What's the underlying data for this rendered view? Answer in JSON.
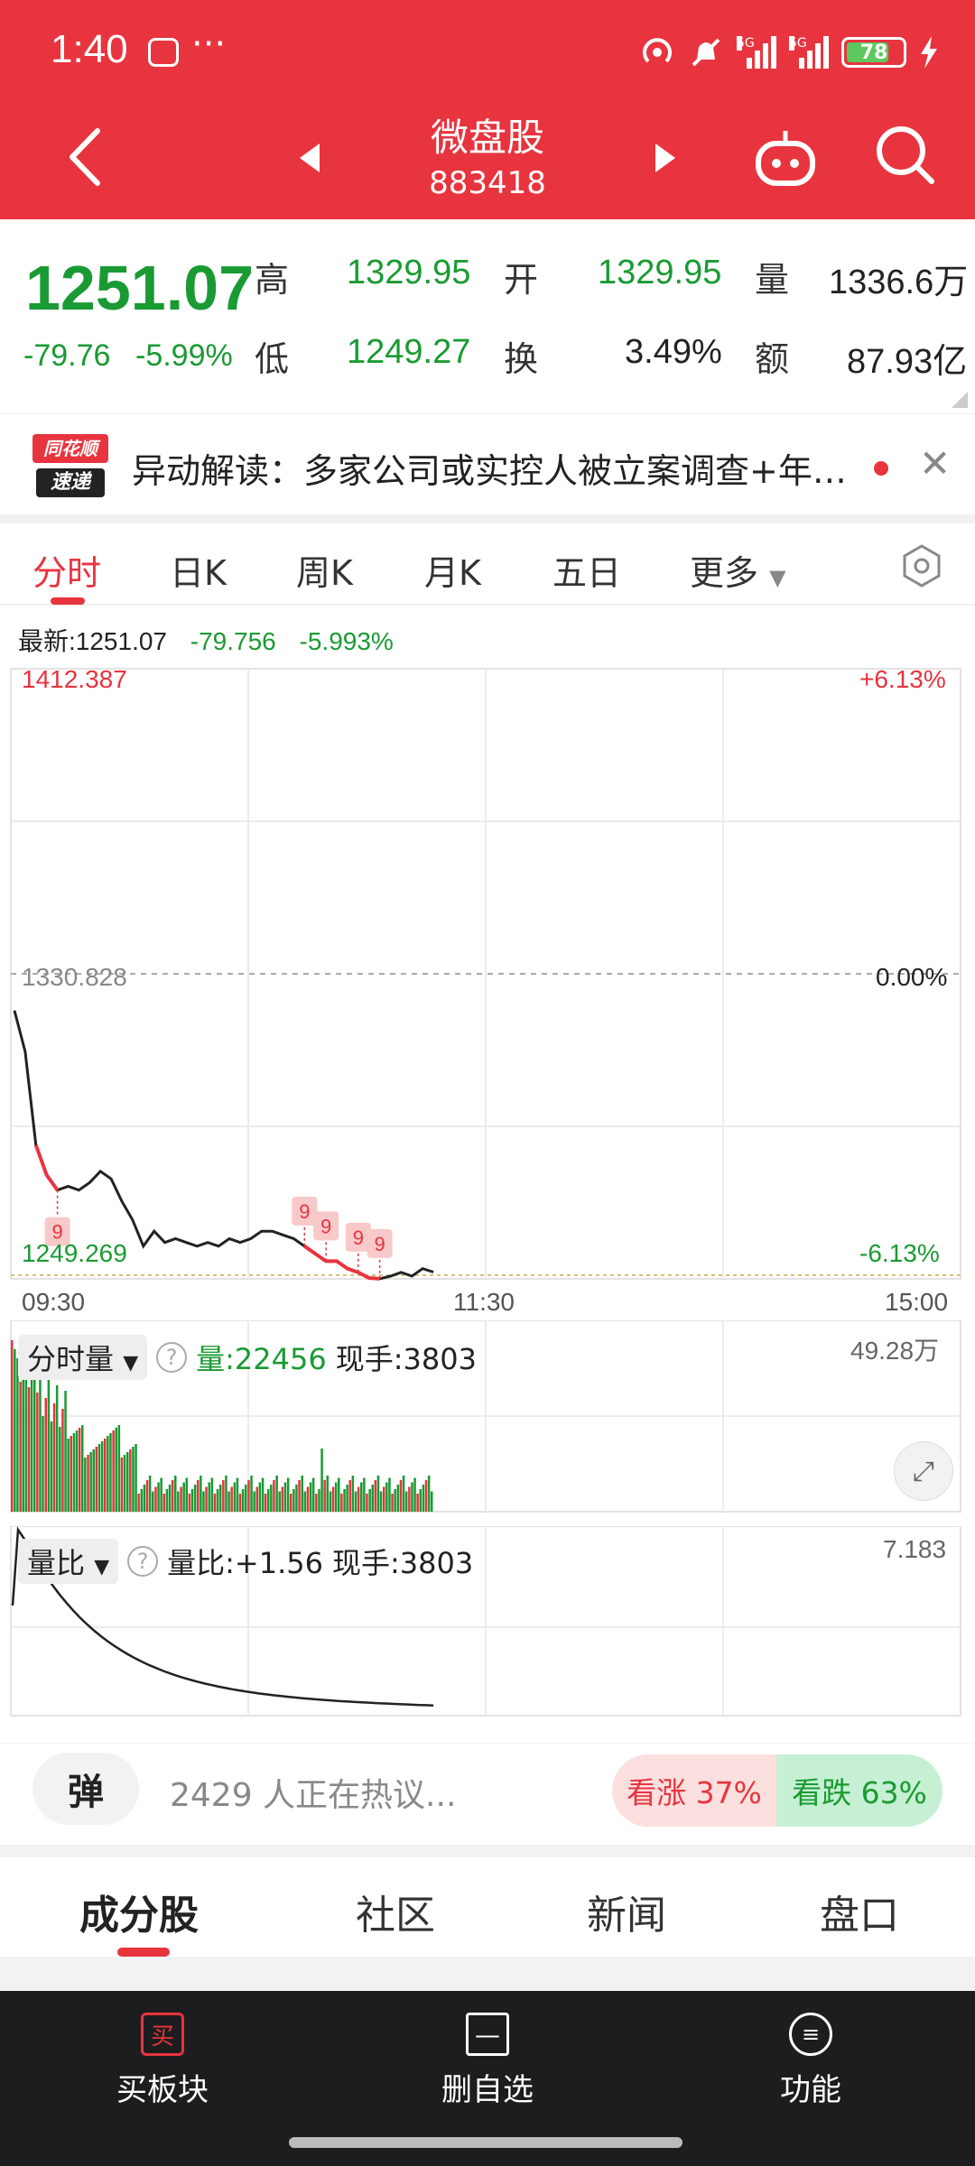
{
  "status_bar": {
    "time": "1:40",
    "more": "···",
    "battery": "78"
  },
  "nav": {
    "title": "微盘股",
    "code": "883418"
  },
  "quote": {
    "price": "1251.07",
    "change": "-79.76",
    "change_pct": "-5.99%",
    "high_label": "高",
    "high": "1329.95",
    "low_label": "低",
    "low": "1249.27",
    "open_label": "开",
    "open": "1329.95",
    "turnover_label": "换",
    "turnover": "3.49%",
    "volume_label": "量",
    "volume": "1336.6万",
    "amount_label": "额",
    "amount": "87.93亿"
  },
  "news": {
    "logo_top": "同花顺",
    "logo_bottom": "速递",
    "text": "异动解读：多家公司或实控人被立案调查+年…"
  },
  "tabs": {
    "items": [
      "分时",
      "日K",
      "周K",
      "月K",
      "五日",
      "更多"
    ]
  },
  "chart_header": {
    "latest": "最新:1251.07",
    "change": "-79.756",
    "change_pct": "-5.993%"
  },
  "price_axis": {
    "top": "1412.387",
    "mid": "1330.828",
    "bottom": "1249.269",
    "top_pct": "+6.13%",
    "mid_pct": "0.00%",
    "bottom_pct": "-6.13%"
  },
  "time_axis": {
    "start": "09:30",
    "mid": "11:30",
    "end": "15:00"
  },
  "volume_panel": {
    "selector": "分时量",
    "volume": "量:22456",
    "hand": "现手:3803",
    "max": "49.28万"
  },
  "ratio_panel": {
    "selector": "量比",
    "ratio": "量比:+1.56",
    "hand": "现手:3803",
    "max": "7.183"
  },
  "marker_label": "9",
  "discussion": {
    "danmu_label": "弹",
    "people": "2429 人正在热议...",
    "bull": "看涨 37%",
    "bear": "看跌 63%"
  },
  "sub_tabs": {
    "items": [
      "成分股",
      "社区",
      "新闻",
      "盘口"
    ]
  },
  "bottom_nav": {
    "buy_icon": "买",
    "buy_label": "买板块",
    "remove_label": "删自选",
    "func_label": "功能"
  },
  "chart_data": {
    "type": "line",
    "title": "",
    "xlabel": "",
    "ylabel": "",
    "x_ticks": [
      "09:30",
      "11:30",
      "15:00"
    ],
    "ylim": [
      1249.269,
      1412.387
    ],
    "reference": 1330.828,
    "series": [
      {
        "values": [
          1321,
          1310,
          1285,
          1277,
          1273,
          1274,
          1273,
          1275,
          1278,
          1276,
          1270,
          1265,
          1258,
          1262,
          1259,
          1260,
          1259,
          1258,
          1259,
          1258,
          1260,
          1259,
          1260,
          1262,
          1262,
          1261,
          1260,
          1258,
          1256,
          1254,
          1254,
          1252,
          1251,
          1249.5,
          1249.3,
          1250,
          1251,
          1250,
          1252,
          1251.07
        ]
      }
    ],
    "volume_max": "49.28万",
    "ratio_max": "7.183"
  }
}
